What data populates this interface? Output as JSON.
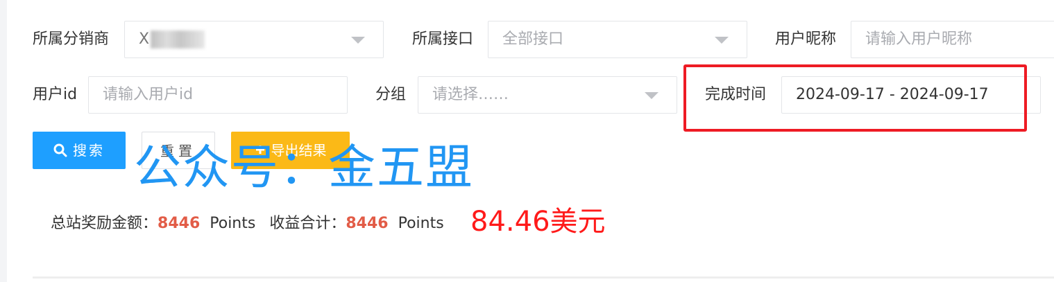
{
  "filters": {
    "distributor": {
      "label": "所属分销商",
      "value": "X"
    },
    "interface": {
      "label": "所属接口",
      "value": "全部接口"
    },
    "nickname": {
      "label": "用户昵称",
      "placeholder": "请输入用户昵称"
    },
    "user_id": {
      "label": "用户id",
      "placeholder": "请输入用户id"
    },
    "group": {
      "label": "分组",
      "placeholder": "请选择……"
    },
    "complete_time": {
      "label": "完成时间",
      "value": "2024-09-17 - 2024-09-17"
    }
  },
  "buttons": {
    "search": "搜索",
    "reset": "重置",
    "export": "导出结果"
  },
  "icons": {
    "search": "search-icon",
    "export": "export-icon",
    "dropdown": "chevron-down-icon"
  },
  "watermark": "公众号：金五盟",
  "stats": {
    "total_reward_label": "总站奖励金额：",
    "total_reward_value": "8446",
    "total_reward_unit": "Points",
    "income_total_label": "收益合计：",
    "income_total_value": "8446",
    "income_total_unit": "Points",
    "usd_amount": "84.46美元"
  },
  "colors": {
    "primary": "#1e9fff",
    "warning": "#fbb917",
    "highlight": "#ee1b24",
    "stat_value": "#e25c47",
    "usd": "#ff1a1a",
    "watermark": "#2196f3"
  }
}
